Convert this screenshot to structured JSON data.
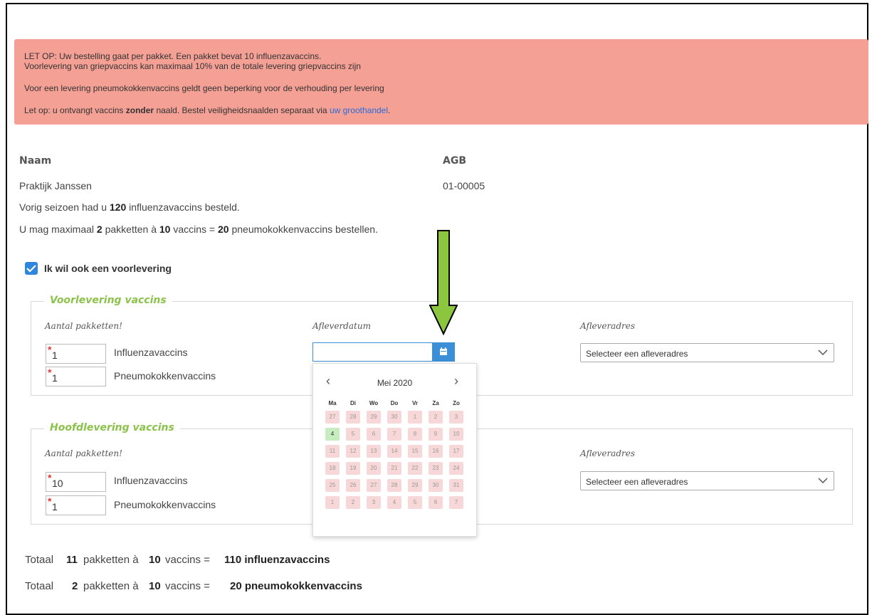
{
  "alert": {
    "line1": "LET OP: Uw bestelling gaat per pakket. Een pakket bevat 10 influenzavaccins.",
    "line2": "Voorlevering van griepvaccins kan maximaal 10% van de totale levering griepvaccins zijn",
    "line3": "Voor een levering pneumokokkenvaccins geldt geen beperking voor de verhouding per levering",
    "line4_pre": "Let op: u ontvangt vaccins ",
    "line4_bold": "zonder",
    "line4_mid": " naald. Bestel veiligheidsnaalden separaat via ",
    "line4_link": "uw groothandel",
    "line4_end": "."
  },
  "info": {
    "naam_label": "Naam",
    "naam_value": "Praktijk Janssen",
    "agb_label": "AGB",
    "agb_value": "01-00005",
    "prev_pre": "Vorig seizoen had u ",
    "prev_num": "120",
    "prev_post": " influenzavaccins besteld.",
    "max_pre": "U mag maximaal ",
    "max_num1": "2",
    "max_mid1": " pakketten à ",
    "max_num2": "10",
    "max_mid2": " vaccins = ",
    "max_num3": "20",
    "max_post": " pneumokokkenvaccins bestellen."
  },
  "voorlevering_checkbox": {
    "label": "Ik wil ook een voorlevering",
    "checked": true
  },
  "voorlevering": {
    "legend": "Voorlevering vaccins",
    "col_aantal": "Aantal pakketten!",
    "col_datum": "Afleverdatum",
    "col_adres": "Afleveradres",
    "influenza_qty": "1",
    "influenza_label": "Influenzavaccins",
    "pneumo_qty": "1",
    "pneumo_label": "Pneumokokkenvaccins",
    "adres_select": "Selecteer een afleveradres"
  },
  "hoofdlevering": {
    "legend": "Hoofdlevering vaccins",
    "col_aantal": "Aantal pakketten!",
    "col_adres": "Afleveradres",
    "influenza_qty": "10",
    "influenza_label": "Influenzavaccins",
    "pneumo_qty": "1",
    "pneumo_label": "Pneumokokkenvaccins",
    "adres_select": "Selecteer een afleveradres"
  },
  "calendar": {
    "month": "Mei 2020",
    "prev_icon": "chevron-left-icon",
    "next_icon": "chevron-right-icon",
    "weekdays": [
      "Ma",
      "Di",
      "Wo",
      "Do",
      "Vr",
      "Za",
      "Zo"
    ],
    "weeks": [
      [
        "27",
        "28",
        "29",
        "30",
        "1",
        "2",
        "3"
      ],
      [
        "4",
        "5",
        "6",
        "7",
        "8",
        "9",
        "10"
      ],
      [
        "11",
        "12",
        "13",
        "14",
        "15",
        "16",
        "17"
      ],
      [
        "18",
        "19",
        "20",
        "21",
        "22",
        "23",
        "24"
      ],
      [
        "25",
        "26",
        "27",
        "28",
        "29",
        "30",
        "31"
      ],
      [
        "1",
        "2",
        "3",
        "4",
        "5",
        "6",
        "7"
      ]
    ],
    "available_day": "4",
    "available_color": "#c6ecc0",
    "disabled_color": "#f7d7d7"
  },
  "totals": {
    "row1": {
      "pre": "Totaal",
      "num": "11",
      "mid": "pakketten à",
      "per": "10",
      "eq": "vaccins =",
      "result": "110 influenzavaccins"
    },
    "row2": {
      "pre": "Totaal",
      "num": "2",
      "mid": "pakketten à",
      "per": "10",
      "eq": "vaccins =",
      "result": "20 pneumokokkenvaccins"
    }
  },
  "colors": {
    "alert_bg": "#f4a095",
    "accent_green": "#8bc34a",
    "primary_blue": "#2e86de",
    "arrow_green": "#8cc63f"
  }
}
